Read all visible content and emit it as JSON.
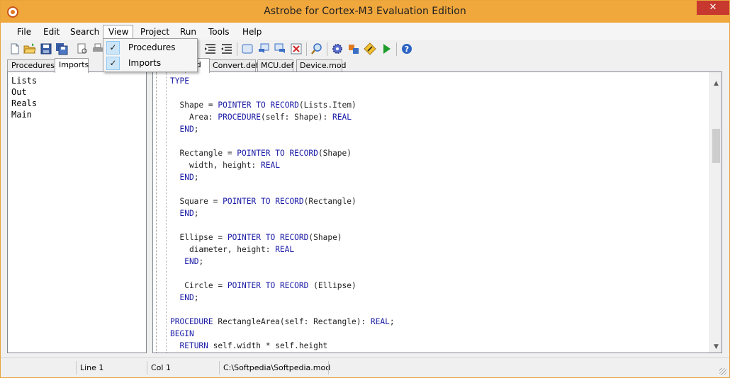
{
  "window": {
    "title": "Astrobe for Cortex-M3 Evaluation Edition",
    "close_label": "✕"
  },
  "menu": {
    "items": [
      "File",
      "Edit",
      "Search",
      "View",
      "Project",
      "Run",
      "Tools",
      "Help"
    ],
    "open_menu": "View",
    "dropdown": [
      {
        "label": "Procedures",
        "checked": true,
        "check": "✓"
      },
      {
        "label": "Imports",
        "checked": true,
        "check": "✓"
      }
    ]
  },
  "toolbar": {
    "icons": [
      "new-file-icon",
      "open-folder-icon",
      "save-icon",
      "save-all-icon",
      "print-preview-icon",
      "print-icon",
      "indent-icon",
      "outdent-icon",
      "frame-icon",
      "comment-icon",
      "uncomment-icon",
      "delete-icon",
      "find-icon",
      "build-gear-icon",
      "link-icon",
      "run-tool-icon",
      "run-play-icon",
      "help-icon"
    ]
  },
  "left_panel": {
    "tabs": [
      "Procedures",
      "Imports"
    ],
    "active_tab": "Imports",
    "items": [
      "Lists",
      "Out",
      "Reals",
      "Main"
    ]
  },
  "editor": {
    "tabs": [
      "od",
      "Convert.def",
      "MCU.def",
      "Device.mod"
    ],
    "active_tab": "od",
    "code_lines": [
      [
        {
          "t": "TYPE",
          "k": true
        }
      ],
      [],
      [
        {
          "t": "  Shape = "
        },
        {
          "t": "POINTER",
          "k": true
        },
        {
          "t": " "
        },
        {
          "t": "TO",
          "k": true
        },
        {
          "t": " "
        },
        {
          "t": "RECORD",
          "k": true
        },
        {
          "t": "(Lists.Item)"
        }
      ],
      [
        {
          "t": "    Area: "
        },
        {
          "t": "PROCEDURE",
          "k": true
        },
        {
          "t": "(self: Shape): "
        },
        {
          "t": "REAL",
          "k": true
        }
      ],
      [
        {
          "t": "  "
        },
        {
          "t": "END",
          "k": true
        },
        {
          "t": ";"
        }
      ],
      [],
      [
        {
          "t": "  Rectangle = "
        },
        {
          "t": "POINTER",
          "k": true
        },
        {
          "t": " "
        },
        {
          "t": "TO",
          "k": true
        },
        {
          "t": " "
        },
        {
          "t": "RECORD",
          "k": true
        },
        {
          "t": "(Shape)"
        }
      ],
      [
        {
          "t": "    width, height: "
        },
        {
          "t": "REAL",
          "k": true
        }
      ],
      [
        {
          "t": "  "
        },
        {
          "t": "END",
          "k": true
        },
        {
          "t": ";"
        }
      ],
      [],
      [
        {
          "t": "  Square = "
        },
        {
          "t": "POINTER",
          "k": true
        },
        {
          "t": " "
        },
        {
          "t": "TO",
          "k": true
        },
        {
          "t": " "
        },
        {
          "t": "RECORD",
          "k": true
        },
        {
          "t": "(Rectangle)"
        }
      ],
      [
        {
          "t": "  "
        },
        {
          "t": "END",
          "k": true
        },
        {
          "t": ";"
        }
      ],
      [],
      [
        {
          "t": "  Ellipse = "
        },
        {
          "t": "POINTER",
          "k": true
        },
        {
          "t": " "
        },
        {
          "t": "TO",
          "k": true
        },
        {
          "t": " "
        },
        {
          "t": "RECORD",
          "k": true
        },
        {
          "t": "(Shape)"
        }
      ],
      [
        {
          "t": "    diameter, height: "
        },
        {
          "t": "REAL",
          "k": true
        }
      ],
      [
        {
          "t": "   "
        },
        {
          "t": "END",
          "k": true
        },
        {
          "t": ";"
        }
      ],
      [],
      [
        {
          "t": "   Circle = "
        },
        {
          "t": "POINTER",
          "k": true
        },
        {
          "t": " "
        },
        {
          "t": "TO",
          "k": true
        },
        {
          "t": " "
        },
        {
          "t": "RECORD",
          "k": true
        },
        {
          "t": " (Ellipse)"
        }
      ],
      [
        {
          "t": "  "
        },
        {
          "t": "END",
          "k": true
        },
        {
          "t": ";"
        }
      ],
      [],
      [
        {
          "t": "PROCEDURE",
          "k": true
        },
        {
          "t": " RectangleArea(self: Rectangle): "
        },
        {
          "t": "REAL",
          "k": true
        },
        {
          "t": ";"
        }
      ],
      [
        {
          "t": "BEGIN",
          "k": true
        }
      ],
      [
        {
          "t": "  "
        },
        {
          "t": "RETURN",
          "k": true
        },
        {
          "t": " self.width * self.height"
        }
      ]
    ]
  },
  "status": {
    "line": "Line 1",
    "col": "Col 1",
    "path": "C:\\Softpedia\\Softpedia.mod"
  }
}
